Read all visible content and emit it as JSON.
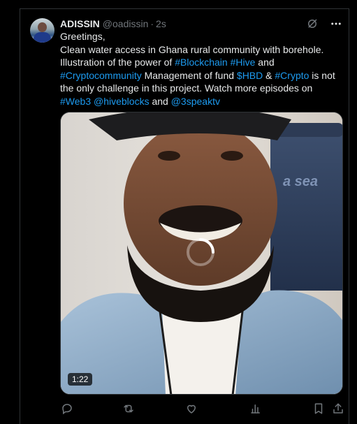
{
  "tweet": {
    "author_name": "ADISSIN",
    "handle": "@oadissin",
    "separator": "·",
    "time": "2s",
    "text_line1": "Greetings,",
    "text_p2_a": "Clean water access in Ghana rural community with borehole. Illustration of the power of ",
    "tag_blockchain": "#Blockchain",
    "tag_hive": "#Hive",
    "text_and1": " and ",
    "tag_cryptocommunity": "#Cryptocommunity",
    "text_mgmt": " Management of fund ",
    "tag_hbd": "$HBD",
    "text_amp": " & ",
    "tag_crypto": "#Crypto",
    "text_rest": " is not the only challenge in this project. Watch more episodes on ",
    "tag_web3": "#Web3",
    "mention_hiveblocks": "@hiveblocks",
    "text_and2": " and ",
    "mention_3speaktv": "@3speaktv"
  },
  "media": {
    "duration": "1:22",
    "chair_text": "a sea"
  },
  "icons": {
    "grok": "grok-icon",
    "more": "more-icon",
    "reply": "reply-icon",
    "retweet": "retweet-icon",
    "like": "like-icon",
    "views": "views-icon",
    "bookmark": "bookmark-icon",
    "share": "share-icon"
  },
  "colors": {
    "background": "#000000",
    "text": "#e7e9ea",
    "muted": "#71767b",
    "link": "#1d9bf0",
    "border": "#2f3336"
  }
}
